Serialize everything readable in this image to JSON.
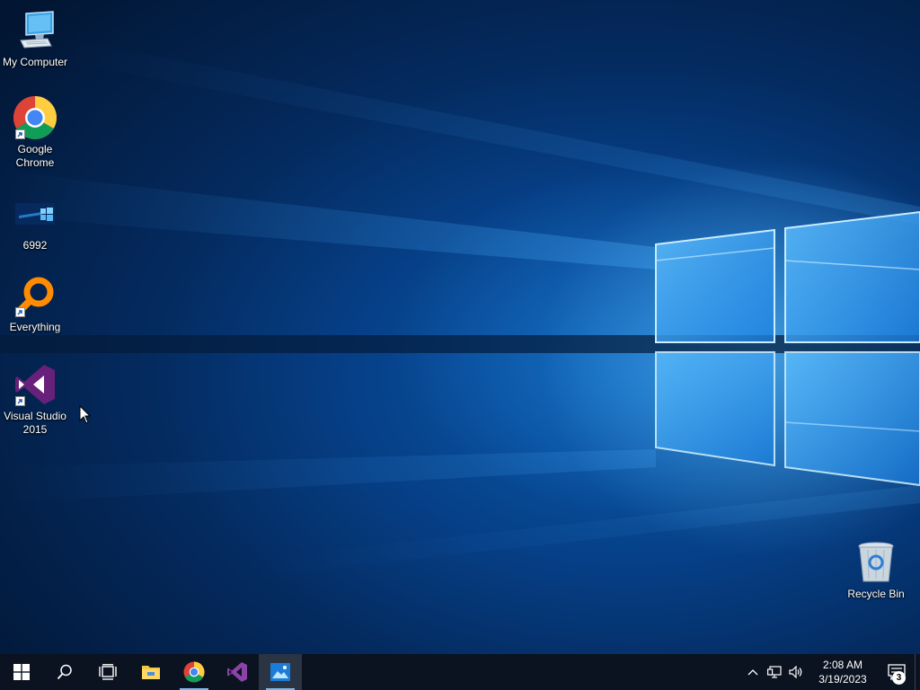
{
  "desktop": {
    "icons": [
      {
        "label": "My Computer",
        "icon": "computer-icon",
        "shortcut": false
      },
      {
        "label": "Google\nChrome",
        "icon": "chrome-icon",
        "shortcut": true
      },
      {
        "label": "6992",
        "icon": "image-file-icon",
        "shortcut": false
      },
      {
        "label": "Everything",
        "icon": "everything-search-icon",
        "shortcut": true
      },
      {
        "label": "Visual Studio\n2015",
        "icon": "visual-studio-icon",
        "shortcut": true
      },
      {
        "label": "Recycle Bin",
        "icon": "recycle-bin-icon",
        "shortcut": false
      }
    ]
  },
  "taskbar": {
    "buttons": [
      {
        "name": "start",
        "icon": "windows-logo-icon"
      },
      {
        "name": "search",
        "icon": "search-icon"
      },
      {
        "name": "task-view",
        "icon": "task-view-icon"
      },
      {
        "name": "file-explorer",
        "icon": "folder-icon"
      },
      {
        "name": "chrome",
        "icon": "chrome-icon",
        "running": true
      },
      {
        "name": "visual-studio",
        "icon": "visual-studio-icon"
      },
      {
        "name": "photos",
        "icon": "photos-icon",
        "running": true,
        "focused": true
      }
    ],
    "tray": {
      "icons": [
        "chevron-up-icon",
        "network-icon",
        "volume-icon"
      ],
      "time": "2:08 AM",
      "date": "3/19/2023",
      "notification_count": "3"
    }
  },
  "colors": {
    "taskbar": "#0b1220",
    "accent": "#76b9ed",
    "vs_purple": "#68217a",
    "everything_orange": "#ff8c00"
  }
}
